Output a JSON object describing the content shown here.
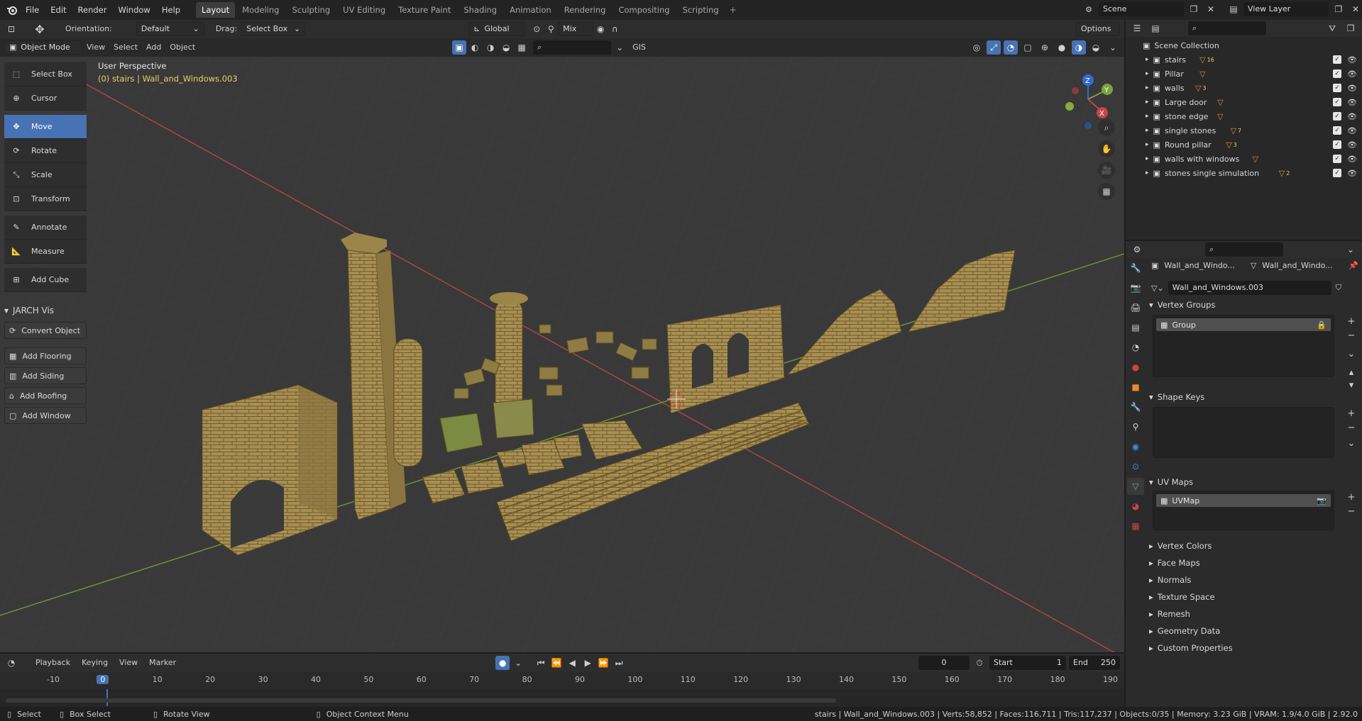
{
  "topbar": {
    "menus": [
      "File",
      "Edit",
      "Render",
      "Window",
      "Help"
    ],
    "workspaces": [
      "Layout",
      "Modeling",
      "Sculpting",
      "UV Editing",
      "Texture Paint",
      "Shading",
      "Animation",
      "Rendering",
      "Compositing",
      "Scripting"
    ],
    "active_workspace": "Layout",
    "scene": "Scene",
    "view_layer": "View Layer"
  },
  "viewport": {
    "orientation_label": "Orientation:",
    "orientation_value": "Default",
    "drag_label": "Drag:",
    "drag_value": "Select Box",
    "transform_space": "Global",
    "pivot_mix": "Mix",
    "options": "Options",
    "mode": "Object Mode",
    "menus": [
      "View",
      "Select",
      "Add",
      "Object"
    ],
    "gis": "GIS",
    "perspective": "User Perspective",
    "selection_info": "(0) stairs | Wall_and_Windows.003"
  },
  "tools": [
    {
      "label": "Select Box",
      "icon": "select-box-icon",
      "active": false
    },
    {
      "label": "Cursor",
      "icon": "cursor-icon",
      "active": false
    },
    {
      "label": "Move",
      "icon": "move-icon",
      "active": true
    },
    {
      "label": "Rotate",
      "icon": "rotate-icon",
      "active": false
    },
    {
      "label": "Scale",
      "icon": "scale-icon",
      "active": false
    },
    {
      "label": "Transform",
      "icon": "transform-icon",
      "active": false
    },
    {
      "label": "Annotate",
      "icon": "annotate-icon",
      "active": false
    },
    {
      "label": "Measure",
      "icon": "measure-icon",
      "active": false
    },
    {
      "label": "Add Cube",
      "icon": "add-cube-icon",
      "active": false
    }
  ],
  "jarch": {
    "title": "JARCH Vis",
    "convert": "Convert Object",
    "buttons": [
      "Add Flooring",
      "Add Siding",
      "Add Roofing",
      "Add Window"
    ]
  },
  "outliner": {
    "root": "Scene Collection",
    "items": [
      {
        "name": "stairs",
        "badge": "16"
      },
      {
        "name": "Pillar",
        "badge": ""
      },
      {
        "name": "walls",
        "badge": "3"
      },
      {
        "name": "Large door",
        "badge": ""
      },
      {
        "name": "stone edge",
        "badge": ""
      },
      {
        "name": "single stones",
        "badge": "7"
      },
      {
        "name": "Round pillar",
        "badge": "3"
      },
      {
        "name": "walls with windows",
        "badge": ""
      },
      {
        "name": "stones single simulation",
        "badge": "2"
      }
    ]
  },
  "properties": {
    "object_name": "Wall_and_Windo...",
    "data_name": "Wall_and_Windo...",
    "mesh_name": "Wall_and_Windows.003",
    "panels": {
      "vertex_groups": "Vertex Groups",
      "group_item": "Group",
      "shape_keys": "Shape Keys",
      "uv_maps": "UV Maps",
      "uv_item": "UVMap"
    },
    "collapsed": [
      "Vertex Colors",
      "Face Maps",
      "Normals",
      "Texture Space",
      "Remesh",
      "Geometry Data",
      "Custom Properties"
    ]
  },
  "timeline": {
    "menus": [
      "Playback",
      "Keying",
      "View",
      "Marker"
    ],
    "current_frame": "0",
    "start_label": "Start",
    "start": "1",
    "end_label": "End",
    "end": "250",
    "ruler": [
      "-10",
      "0",
      "10",
      "20",
      "30",
      "40",
      "50",
      "60",
      "70",
      "80",
      "90",
      "100",
      "110",
      "120",
      "130",
      "140",
      "150",
      "160",
      "170",
      "180",
      "190"
    ]
  },
  "statusbar": {
    "select": "Select",
    "box_select": "Box Select",
    "rotate_view": "Rotate View",
    "context_menu": "Object Context Menu",
    "stats": "stairs | Wall_and_Windows.003 | Verts:58,852 | Faces:116,711 | Tris:117,237 | Objects:0/35 | Memory: 3.23 GiB | VRAM: 1.9/4.0 GiB | 2.92.0"
  },
  "colors": {
    "accent": "#4772b3",
    "x_axis": "#c7454b",
    "y_axis": "#7aa43a",
    "stone": "#a88f52"
  }
}
